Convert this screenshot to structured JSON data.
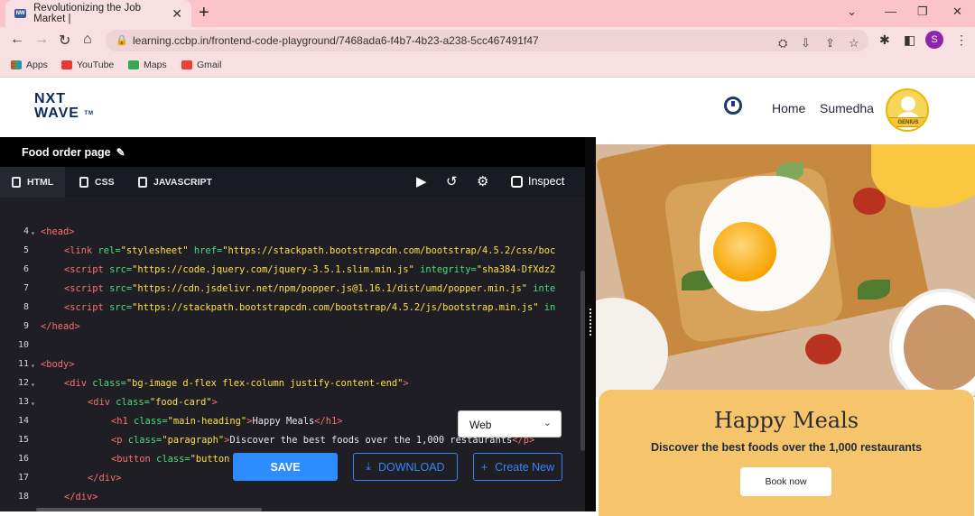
{
  "browser": {
    "tab_title": "Revolutionizing the Job Market |",
    "url": "learning.ccbp.in/frontend-code-playground/7468ada6-f4b7-4b23-a238-5cc467491f47",
    "profile_initial": "S",
    "bookmarks": [
      {
        "label": "Apps"
      },
      {
        "label": "YouTube"
      },
      {
        "label": "Maps"
      },
      {
        "label": "Gmail"
      }
    ]
  },
  "site": {
    "logo_line1": "NXT",
    "logo_line2": "WAVE",
    "logo_tm": "TM",
    "nav_home": "Home",
    "user_name": "Sumedha",
    "badge_label": "GENIUS"
  },
  "editor": {
    "title": "Food order page",
    "tabs": [
      {
        "label": "HTML"
      },
      {
        "label": "CSS"
      },
      {
        "label": "JAVASCRIPT"
      }
    ],
    "inspect_label": "Inspect",
    "lines": [
      {
        "n": "4",
        "fold": true,
        "indent": 0,
        "html": "<span class=\"tg\">&lt;head&gt;</span>"
      },
      {
        "n": "5",
        "fold": false,
        "indent": 1,
        "html": "<span class=\"tg\">&lt;link</span> <span class=\"at\">rel=</span><span class=\"st\">\"stylesheet\"</span> <span class=\"at\">href=</span><span class=\"st\">\"https://stackpath.bootstrapcdn.com/bootstrap/4.5.2/css/boc</span>"
      },
      {
        "n": "6",
        "fold": false,
        "indent": 1,
        "html": "<span class=\"tg\">&lt;script</span> <span class=\"at\">src=</span><span class=\"st\">\"https://code.jquery.com/jquery-3.5.1.slim.min.js\"</span> <span class=\"at\">integrity=</span><span class=\"st\">\"sha384-DfXdz2</span>"
      },
      {
        "n": "7",
        "fold": false,
        "indent": 1,
        "html": "<span class=\"tg\">&lt;script</span> <span class=\"at\">src=</span><span class=\"st\">\"https://cdn.jsdelivr.net/npm/popper.js@1.16.1/dist/umd/popper.min.js\"</span> <span class=\"at\">inte</span>"
      },
      {
        "n": "8",
        "fold": false,
        "indent": 1,
        "html": "<span class=\"tg\">&lt;script</span> <span class=\"at\">src=</span><span class=\"st\">\"https://stackpath.bootstrapcdn.com/bootstrap/4.5.2/js/bootstrap.min.js\"</span> <span class=\"at\">in</span>"
      },
      {
        "n": "9",
        "fold": false,
        "indent": 0,
        "html": "<span class=\"tg\">&lt;/head&gt;</span>"
      },
      {
        "n": "10",
        "fold": false,
        "indent": 0,
        "html": ""
      },
      {
        "n": "11",
        "fold": true,
        "indent": 0,
        "html": "<span class=\"tg\">&lt;body&gt;</span>"
      },
      {
        "n": "12",
        "fold": true,
        "indent": 1,
        "html": "<span class=\"tg\">&lt;div</span> <span class=\"at\">class=</span><span class=\"st\">\"bg-image d-flex flex-column justify-content-end\"</span><span class=\"tg\">&gt;</span>"
      },
      {
        "n": "13",
        "fold": true,
        "indent": 2,
        "html": "<span class=\"tg\">&lt;div</span> <span class=\"at\">class=</span><span class=\"st\">\"food-card\"</span><span class=\"tg\">&gt;</span>"
      },
      {
        "n": "14",
        "fold": false,
        "indent": 3,
        "html": "<span class=\"tg\">&lt;h1</span> <span class=\"at\">class=</span><span class=\"st\">\"main-heading\"</span><span class=\"tg\">&gt;</span>Happy Meals<span class=\"tg\">&lt;/h1&gt;</span>"
      },
      {
        "n": "15",
        "fold": false,
        "indent": 3,
        "html": "<span class=\"tg\">&lt;p</span> <span class=\"at\">class=</span><span class=\"st\">\"paragraph\"</span><span class=\"tg\">&gt;</span>Discover the best foods over the 1,000 restaurants<span class=\"tg\">&lt;/p&gt;</span>"
      },
      {
        "n": "16",
        "fold": false,
        "indent": 3,
        "html": "<span class=\"tg\">&lt;button</span> <span class=\"at\">class=</span><span class=\"st\">\"button</span>"
      },
      {
        "n": "17",
        "fold": false,
        "indent": 2,
        "html": "<span class=\"tg\">&lt;/div&gt;</span>"
      },
      {
        "n": "18",
        "fold": false,
        "indent": 1,
        "html": "<span class=\"tg\">&lt;/div&gt;</span>"
      }
    ],
    "view_select": "Web",
    "save_label": "SAVE",
    "download_label": "DOWNLOAD",
    "create_label": "Create New"
  },
  "preview": {
    "heading": "Happy Meals",
    "paragraph": "Discover the best foods over the 1,000 restaurants",
    "button_label": "Book now"
  },
  "colors": {
    "accent": "#2d8cff",
    "card": "#f6c46a",
    "browser": "#fbc4c9"
  }
}
